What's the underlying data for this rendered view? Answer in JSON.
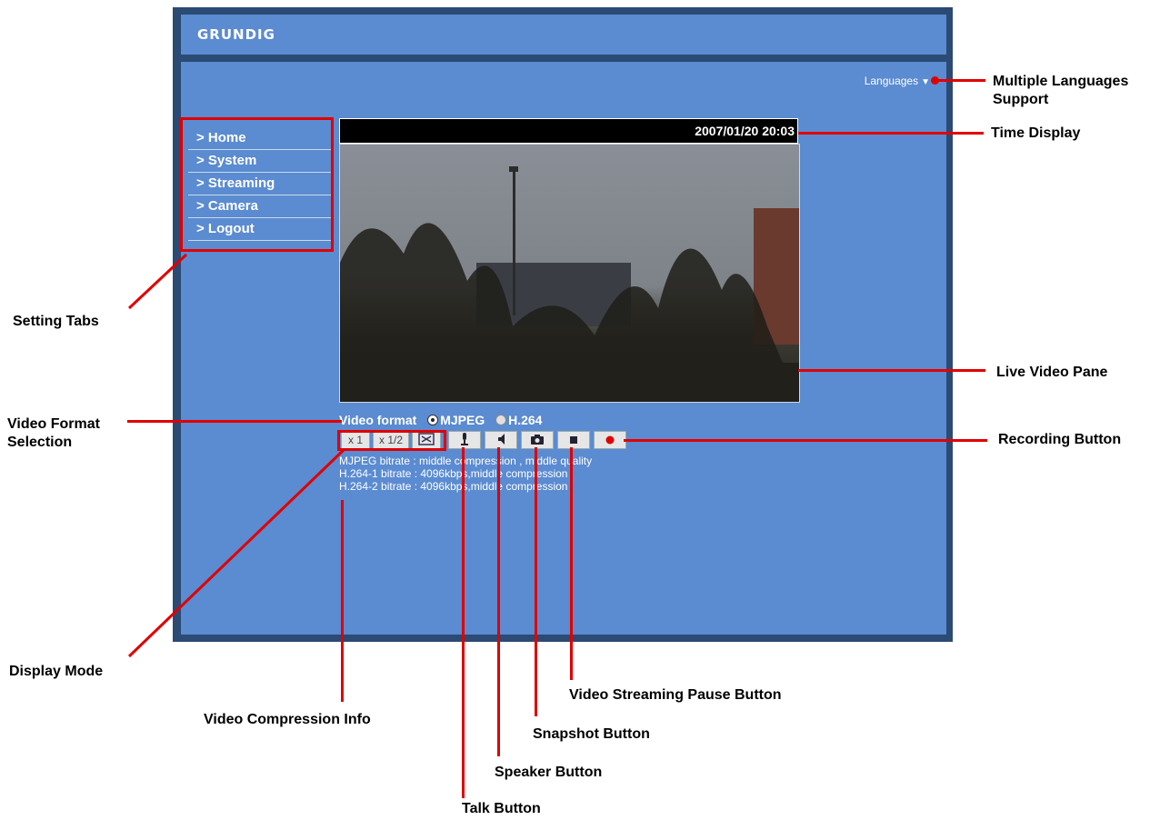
{
  "header": {
    "logo_text": "GRUNDIG"
  },
  "top": {
    "languages_label": "Languages",
    "arrow": "▼"
  },
  "menu": {
    "items": [
      {
        "label": "> Home"
      },
      {
        "label": "> System"
      },
      {
        "label": "> Streaming"
      },
      {
        "label": "> Camera"
      },
      {
        "label": "> Logout"
      }
    ]
  },
  "video": {
    "datetime": "2007/01/20 20:03"
  },
  "format": {
    "label": "Video format",
    "option1": "MJPEG",
    "option2": "H.264",
    "selected": "MJPEG"
  },
  "controls": {
    "x1": "x 1",
    "xhalf": "x 1/2",
    "icons": [
      "fullscreen-icon",
      "microphone-icon",
      "speaker-icon",
      "camera-icon",
      "stop-icon",
      "record-icon"
    ]
  },
  "info": {
    "lines": [
      "MJPEG bitrate : middle compression , middle quality",
      "H.264-1 bitrate : 4096kbps,middle compression",
      "H.264-2 bitrate : 4096kbps,middle compression"
    ]
  },
  "callouts": {
    "languages": [
      "Multiple Languages",
      "Support"
    ],
    "time": "Time Display",
    "tabs": "Setting Tabs",
    "live": "Live Video Pane",
    "format": [
      "Video Format",
      "Selection"
    ],
    "record": "Recording Button",
    "display": "Display Mode",
    "pause": "Video Streaming Pause Button",
    "compression": "Video Compression Info",
    "snapshot": "Snapshot Button",
    "speaker": "Speaker Button",
    "talk": "Talk Button"
  },
  "colors": {
    "accent": "#5b8bd1",
    "frame": "#2b4a74",
    "callout_line": "#e00000"
  }
}
